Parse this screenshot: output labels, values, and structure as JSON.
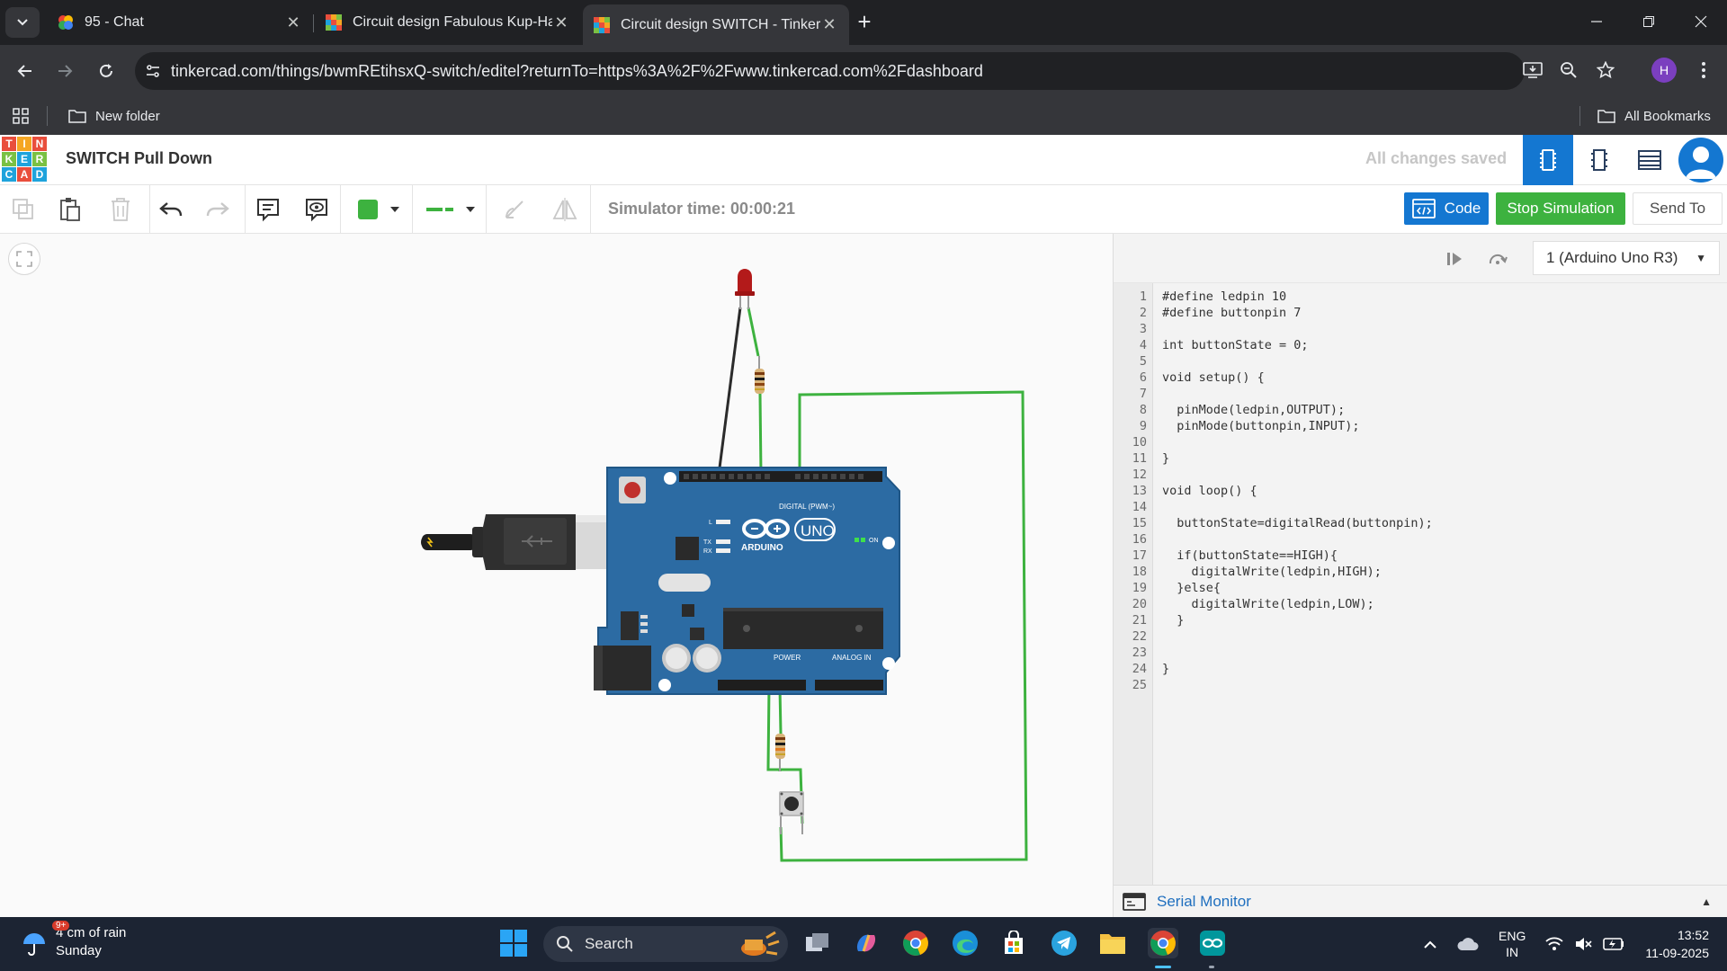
{
  "browser": {
    "tabs": [
      {
        "title": "95 - Chat",
        "active": false
      },
      {
        "title": "Circuit design Fabulous Kup-Ha",
        "active": false
      },
      {
        "title": "Circuit design SWITCH - Tinkerc",
        "active": true
      }
    ],
    "url": "tinkercad.com/things/bwmREtihsxQ-switch/editel?returnTo=https%3A%2F%2Fwww.tinkercad.com%2Fdashboard",
    "profile_initial": "H",
    "bookmarks": {
      "folder": "New folder",
      "all": "All Bookmarks"
    }
  },
  "header": {
    "logo_letters": [
      "T",
      "I",
      "N",
      "K",
      "E",
      "R",
      "C",
      "A",
      "D"
    ],
    "project_title": "SWITCH Pull Down",
    "save_status": "All changes saved"
  },
  "toolbar": {
    "sim_time": "Simulator time: 00:00:21",
    "code_label": "Code",
    "stop_label": "Stop Simulation",
    "send_label": "Send To",
    "fill_color": "#3db23f"
  },
  "board": {
    "brand": "ARDUINO",
    "model": "UNO",
    "on_label": "ON",
    "digital_label": "DIGITAL (PWM~)",
    "power_label": "POWER",
    "analog_label": "ANALOG IN",
    "l_label": "L",
    "tx_label": "TX",
    "rx_label": "RX"
  },
  "code_panel": {
    "device": "1 (Arduino Uno R3)",
    "lines": [
      "#define ledpin 10",
      "#define buttonpin 7",
      "",
      "int buttonState = 0;",
      "",
      "void setup() {",
      "",
      "  pinMode(ledpin,OUTPUT);",
      "  pinMode(buttonpin,INPUT);",
      "",
      "}",
      "",
      "void loop() {",
      "",
      "  buttonState=digitalRead(buttonpin);",
      "",
      "  if(buttonState==HIGH){",
      "    digitalWrite(ledpin,HIGH);",
      "  }else{",
      "    digitalWrite(ledpin,LOW);",
      "  }",
      "",
      "",
      "}",
      ""
    ],
    "serial_monitor": "Serial Monitor"
  },
  "taskbar": {
    "weather_main": "4 cm of rain",
    "weather_sub": "Sunday",
    "weather_badge": "9+",
    "search_placeholder": "Search",
    "lang_top": "ENG",
    "lang_bottom": "IN",
    "time": "13:52",
    "date": "11-09-2025"
  }
}
